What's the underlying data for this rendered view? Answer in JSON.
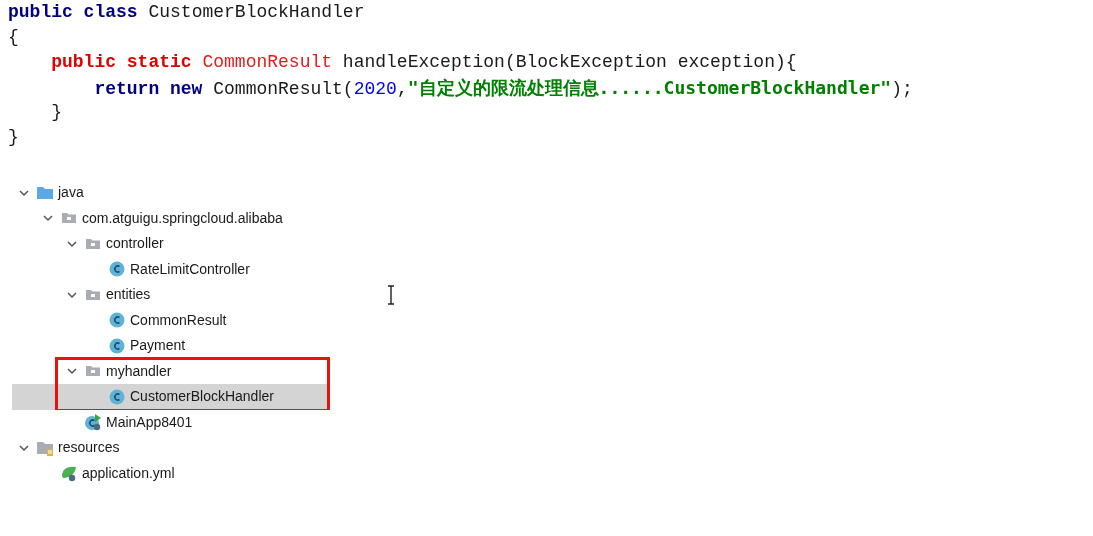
{
  "code_lines": [
    {
      "tokens": [
        {
          "kind": "keyword",
          "text": "public class "
        },
        {
          "kind": "plain",
          "text": "CustomerBlockHandler"
        }
      ]
    },
    {
      "tokens": [
        {
          "kind": "plain",
          "text": "{"
        }
      ],
      "children": [
        {
          "tokens": [
            {
              "kind": "keyword_marked",
              "text": "public static "
            },
            {
              "kind": "type_marked",
              "text": "CommonResult"
            },
            {
              "kind": "plain",
              "text": " handleException(BlockException exception){"
            }
          ],
          "children": [
            {
              "tokens": [
                {
                  "kind": "keyword",
                  "text": "return new "
                },
                {
                  "kind": "plain",
                  "text": "CommonResult("
                },
                {
                  "kind": "number",
                  "text": "2020"
                },
                {
                  "kind": "plain",
                  "text": ","
                },
                {
                  "kind": "string",
                  "text": "\"自定义的限流处理信息......CustomerBlockHandler\""
                },
                {
                  "kind": "plain",
                  "text": ");"
                }
              ]
            }
          ]
        },
        {
          "tokens": [
            {
              "kind": "plain",
              "text": "}"
            }
          ]
        }
      ]
    },
    {
      "tokens": [
        {
          "kind": "plain",
          "text": "}"
        }
      ]
    }
  ],
  "project_tree": [
    {
      "kind": "source_folder",
      "label": "java",
      "expanded": true,
      "selected": false,
      "children": [
        {
          "kind": "package",
          "label": "com.atguigu.springcloud.alibaba",
          "expanded": true,
          "selected": false,
          "children": [
            {
              "kind": "package",
              "label": "controller",
              "expanded": true,
              "selected": false,
              "children": [
                {
                  "kind": "class",
                  "label": "RateLimitController",
                  "selected": false
                }
              ]
            },
            {
              "kind": "package",
              "label": "entities",
              "expanded": true,
              "selected": false,
              "children": [
                {
                  "kind": "class",
                  "label": "CommonResult",
                  "selected": false
                },
                {
                  "kind": "class",
                  "label": "Payment",
                  "selected": false
                }
              ]
            },
            {
              "kind": "package",
              "label": "myhandler",
              "expanded": true,
              "selected": false,
              "boxed": true,
              "children": [
                {
                  "kind": "class",
                  "label": "CustomerBlockHandler",
                  "selected": true
                }
              ]
            },
            {
              "kind": "app_class",
              "label": "MainApp8401",
              "selected": false
            }
          ]
        }
      ]
    },
    {
      "kind": "resources_folder",
      "label": "resources",
      "expanded": true,
      "selected": false,
      "children": [
        {
          "kind": "yml_file",
          "label": "application.yml",
          "selected": false
        }
      ]
    }
  ]
}
